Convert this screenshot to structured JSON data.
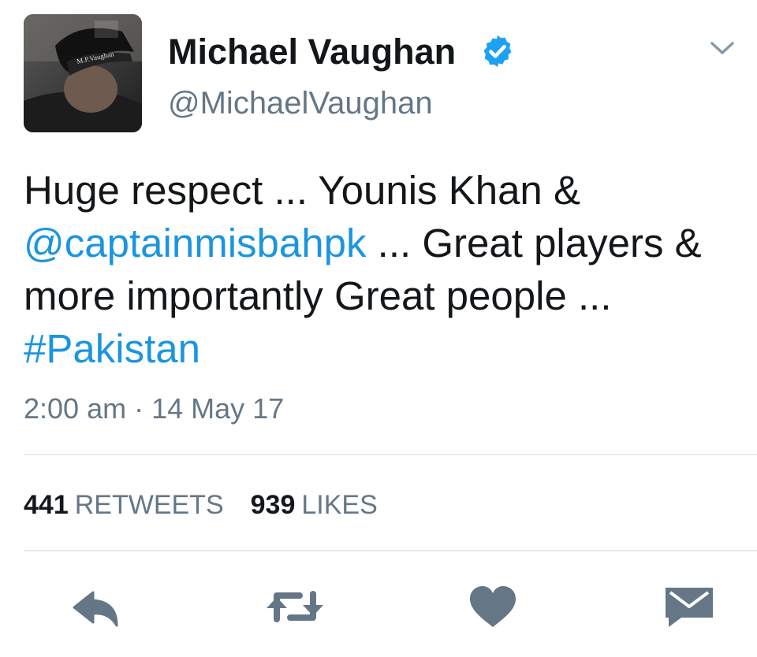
{
  "user": {
    "display_name": "Michael Vaughan",
    "handle": "@MichaelVaughan",
    "verified": true,
    "avatar_text": "M.P.Vaughan"
  },
  "tweet": {
    "part1": "Huge respect ... Younis Khan & ",
    "mention": "@captainmisbahpk",
    "part2": " ... Great players & more importantly Great people ... ",
    "hashtag": "#Pakistan"
  },
  "timestamp": "2:00 am · 14 May 17",
  "stats": {
    "retweets_count": "441",
    "retweets_label": "RETWEETS",
    "likes_count": "939",
    "likes_label": "LIKES"
  },
  "actions": [
    "reply-icon",
    "retweet-icon",
    "like-icon",
    "direct-message-icon"
  ],
  "colors": {
    "link": "#1b95e0",
    "secondary_text": "#657786",
    "icon": "#657786",
    "divider": "#e6ecf0",
    "verified": "#1da1f2"
  }
}
